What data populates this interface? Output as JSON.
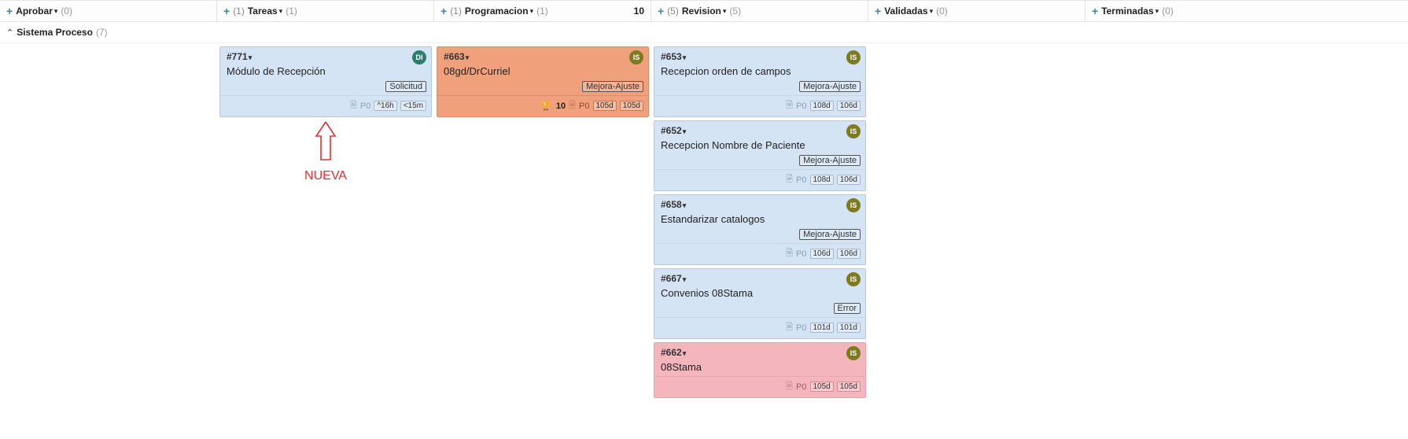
{
  "columns": [
    {
      "name": "Aprobar",
      "count": "(0)",
      "pre": ""
    },
    {
      "name": "Tareas",
      "count": "(1)",
      "pre": "(1)"
    },
    {
      "name": "Programacion",
      "count": "(1)",
      "pre": "(1)",
      "limit": "10"
    },
    {
      "name": "Revision",
      "count": "(5)",
      "pre": "(5)"
    },
    {
      "name": "Validadas",
      "count": "(0)",
      "pre": ""
    },
    {
      "name": "Terminadas",
      "count": "(0)",
      "pre": ""
    }
  ],
  "swimlane": {
    "name": "Sistema Proceso",
    "count": "(7)"
  },
  "annotation": "NUEVA",
  "cards": {
    "tareas": {
      "id": "#771",
      "title": "Módulo de Recepción",
      "avatar": "DI",
      "tag": "Solicitud",
      "priority": "P0",
      "time_a": "^16h",
      "time_b": "<15m"
    },
    "programacion": {
      "id": "#663",
      "title": "08gd/DrCurriel",
      "avatar": "IS",
      "tag": "Mejora-Ajuste",
      "votes": "10",
      "priority": "P0",
      "time_a": "105d",
      "time_b": "105d"
    },
    "revision": [
      {
        "id": "#653",
        "title": "Recepcion orden de campos",
        "avatar": "IS",
        "tag": "Mejora-Ajuste",
        "priority": "P0",
        "time_a": "108d",
        "time_b": "106d"
      },
      {
        "id": "#652",
        "title": "Recepcion Nombre de Paciente",
        "avatar": "IS",
        "tag": "Mejora-Ajuste",
        "priority": "P0",
        "time_a": "108d",
        "time_b": "106d"
      },
      {
        "id": "#658",
        "title": "Estandarizar catalogos",
        "avatar": "IS",
        "tag": "Mejora-Ajuste",
        "priority": "P0",
        "time_a": "106d",
        "time_b": "106d"
      },
      {
        "id": "#667",
        "title": "Convenios 08Stama",
        "avatar": "IS",
        "tag": "Error",
        "priority": "P0",
        "time_a": "101d",
        "time_b": "101d"
      },
      {
        "id": "#662",
        "title": "08Stama",
        "avatar": "IS",
        "tag": "",
        "priority": "P0",
        "time_a": "105d",
        "time_b": "105d",
        "pink": true
      }
    ]
  }
}
